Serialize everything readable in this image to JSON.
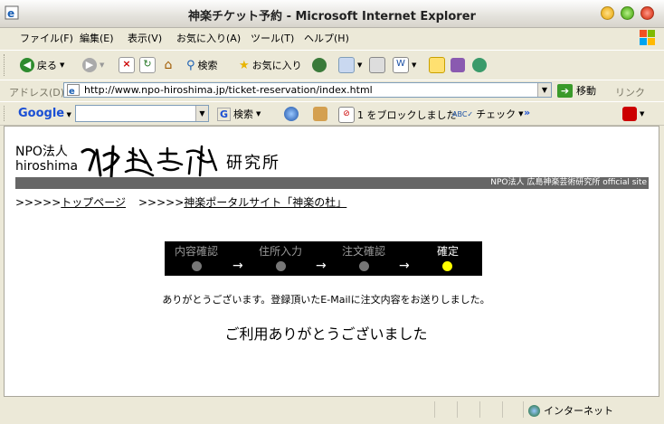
{
  "window": {
    "title": "神楽チケット予約 - Microsoft Internet Explorer"
  },
  "menu": [
    "ファイル(F)",
    "編集(E)",
    "表示(V)",
    "お気に入り(A)",
    "ツール(T)",
    "ヘルプ(H)"
  ],
  "toolbar": {
    "back": "戻る",
    "search": "検索",
    "favorites": "お気に入り"
  },
  "address": {
    "label": "アドレス(D)",
    "url": "http://www.npo-hiroshima.jp/ticket-reservation/index.html",
    "go": "移動",
    "links": "リンク"
  },
  "google": {
    "logo": "Google",
    "search": "検索",
    "blocked": "1 をブロックしました",
    "check": "チェック"
  },
  "page": {
    "org_line1": "NPO法人",
    "org_line2": "hiroshima",
    "brand_caption": "研究所",
    "site_banner": "NPO法人 広島神楽芸術研究所 official site",
    "nav_prefix1": ">>>>>",
    "nav_link1": "トップページ",
    "nav_prefix2": ">>>>>",
    "nav_link2": "神楽ポータルサイト「神楽の杜」",
    "steps": [
      {
        "label": "内容確認",
        "active": false
      },
      {
        "label": "住所入力",
        "active": false
      },
      {
        "label": "注文確認",
        "active": false
      },
      {
        "label": "確定",
        "active": true
      }
    ],
    "arrow": "→",
    "message": "ありがとうございます。登録頂いたE-Mailに注文内容をお送りしました。",
    "thanks": "ご利用ありがとうございました"
  },
  "status": {
    "zone": "インターネット"
  },
  "colors": {
    "step_active_dot": "#ffff00",
    "step_inactive_dot": "#777777",
    "banner_bg": "#666666"
  }
}
